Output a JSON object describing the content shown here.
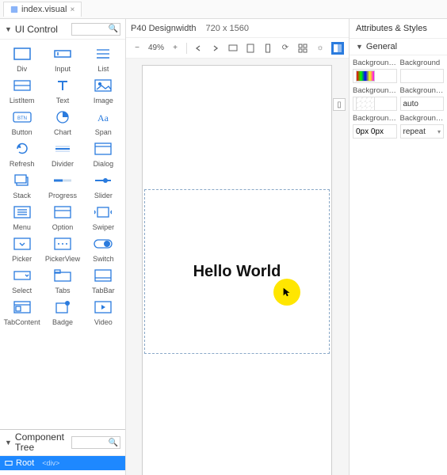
{
  "tab": {
    "filename": "index.visual"
  },
  "left": {
    "title": "UI Control",
    "controls": [
      "Div",
      "Input",
      "List",
      "ListItem",
      "Text",
      "Image",
      "Button",
      "Chart",
      "Span",
      "Refresh",
      "Divider",
      "Dialog",
      "Stack",
      "Progress",
      "Slider",
      "Menu",
      "Option",
      "Swiper",
      "Picker",
      "PickerView",
      "Switch",
      "Select",
      "Tabs",
      "TabBar",
      "TabContent",
      "Badge",
      "Video"
    ],
    "componentTreeTitle1": "Component",
    "componentTreeTitle2": "Tree",
    "rootNode": {
      "name": "Root",
      "kind": "<div>"
    }
  },
  "center": {
    "device": "P40 Designwidth",
    "resolution": "720 x 1560",
    "zoom": "49%",
    "canvasText": "Hello World"
  },
  "right": {
    "title": "Attributes & Styles",
    "sectionGeneral": "General",
    "props": {
      "bgColorLabel": "Background...",
      "bgLabel": "Background",
      "bgImageLabel": "Background...",
      "bgSizeLabel": "Background...",
      "bgSizeValue": "auto",
      "bgPosLabel": "Background...",
      "bgPosValue": "0px 0px",
      "bgRepeatLabel": "Background...",
      "bgRepeatValue": "repeat"
    }
  }
}
